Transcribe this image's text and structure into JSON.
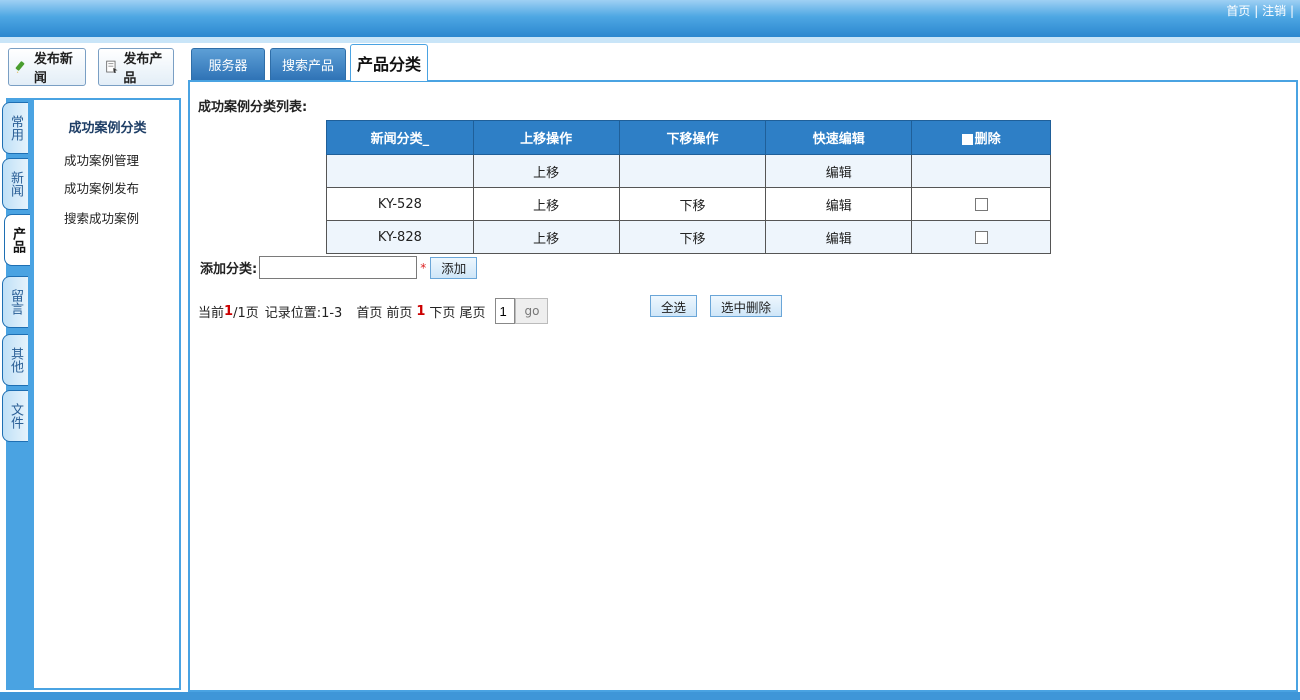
{
  "toplinks": {
    "home": "首页",
    "sep1": "|",
    "logout": "注销",
    "sep2": "|"
  },
  "actions": {
    "publish_news": "发布新闻",
    "publish_product": "发布产品"
  },
  "vtabs": [
    {
      "label": "常用"
    },
    {
      "label": "新闻"
    },
    {
      "label": "产品",
      "active": true
    },
    {
      "label": "留言"
    },
    {
      "label": "其他"
    },
    {
      "label": "文件"
    }
  ],
  "sidebar": {
    "title": "成功案例分类",
    "links": [
      "成功案例管理",
      "成功案例发布",
      "搜索成功案例"
    ]
  },
  "tabs": [
    {
      "label": "服务器"
    },
    {
      "label": "搜索产品"
    },
    {
      "label": "产品分类",
      "active": true
    }
  ],
  "list_title": "成功案例分类列表:",
  "table": {
    "headers": [
      "新闻分类_",
      "上移操作",
      "下移操作",
      "快速编辑",
      "删除"
    ],
    "rows": [
      {
        "name": "",
        "up": "上移",
        "down": "",
        "edit": "编辑",
        "has_checkbox": false
      },
      {
        "name": "KY-528",
        "up": "上移",
        "down": "下移",
        "edit": "编辑",
        "has_checkbox": true
      },
      {
        "name": "KY-828",
        "up": "上移",
        "down": "下移",
        "edit": "编辑",
        "has_checkbox": true
      }
    ]
  },
  "add": {
    "label": "添加分类:",
    "value": "",
    "required_mark": "*",
    "button": "添加"
  },
  "pager": {
    "current_prefix": "当前",
    "current_page": "1",
    "total": "/1页",
    "records": "记录位置:1-3",
    "first": "首页",
    "prev": "前页",
    "page_num": "1",
    "next": "下页",
    "last": "尾页",
    "input_value": "1",
    "go": "go"
  },
  "buttons": {
    "select_all": "全选",
    "delete_selected": "选中删除"
  },
  "colors": {
    "header_blue": "#2e7fc6",
    "accent": "#4aa3e2"
  }
}
